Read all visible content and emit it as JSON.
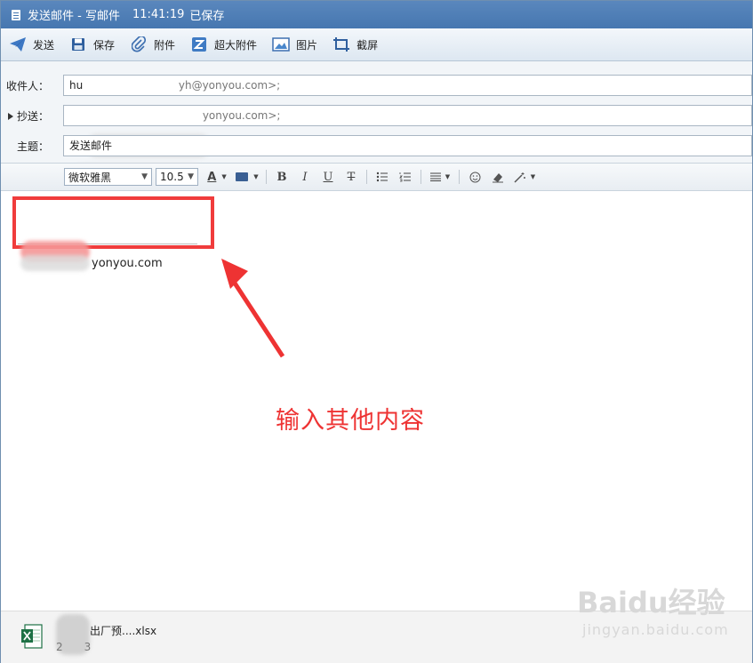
{
  "window": {
    "title": "发送邮件 - 写邮件",
    "time": "11:41:19",
    "status": "已保存"
  },
  "toolbar": {
    "send": "发送",
    "save": "保存",
    "attach": "附件",
    "big_attach": "超大附件",
    "image": "图片",
    "screenshot": "截屏"
  },
  "fields": {
    "to_label": "收件人：",
    "to_value_prefix": "hu",
    "to_value_suffix": "yh@yonyou.com>;",
    "cc_label": "抄送：",
    "cc_value_suffix": "yonyou.com>;",
    "subject_label": "主题：",
    "subject_value": "发送邮件"
  },
  "format": {
    "font": "微软雅黑",
    "size": "10.5"
  },
  "body": {
    "email_text": "yonyou.com",
    "annotation": "输入其他内容"
  },
  "attachment": {
    "name": "出厂预....xlsx",
    "size_prefix": "2",
    "size_suffix": "3"
  },
  "watermark": {
    "brand": "Baidu经验",
    "url": "jingyan.baidu.com"
  },
  "colors": {
    "title_bar": "#4677b0",
    "highlight": "#f03c3c",
    "annotation": "#ee3333"
  }
}
